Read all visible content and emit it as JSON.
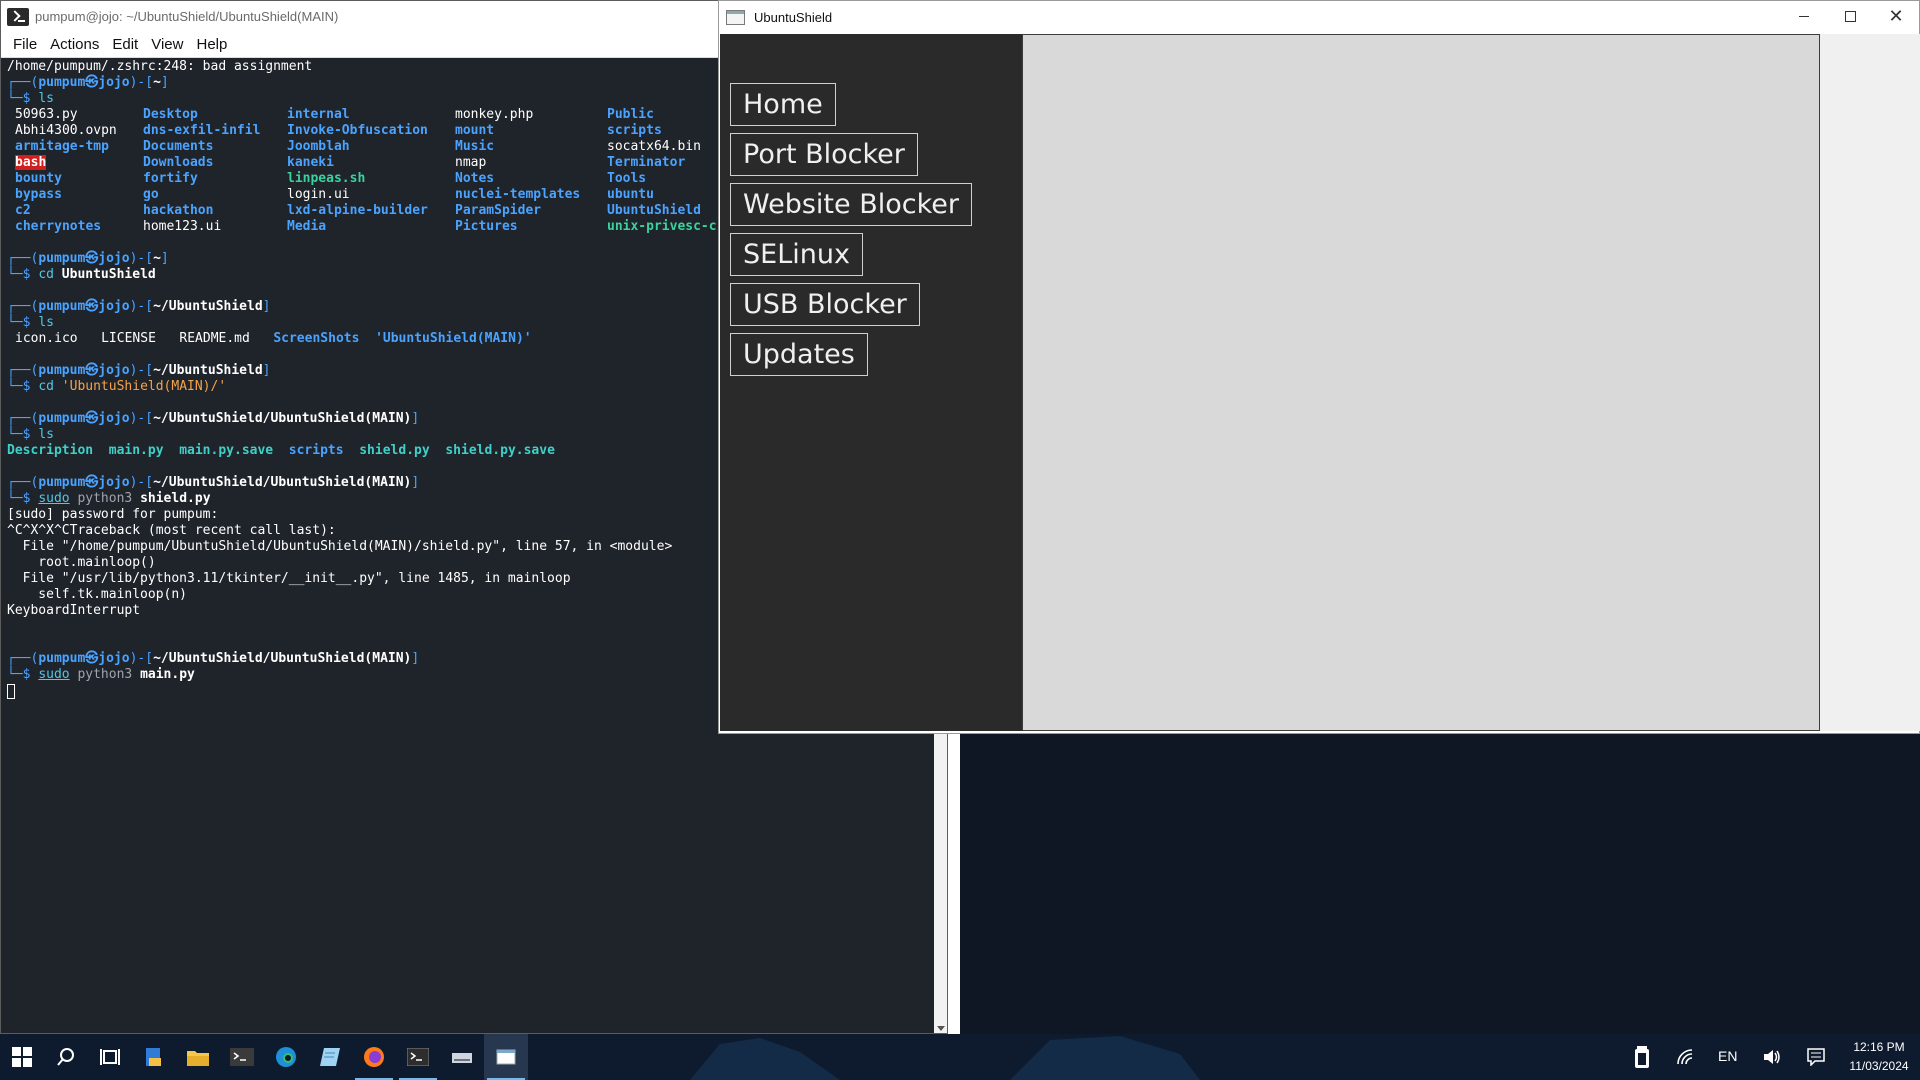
{
  "terminal": {
    "title": "pumpum@jojo: ~/UbuntuShield/UbuntuShield(MAIN)",
    "menu": [
      "File",
      "Actions",
      "Edit",
      "View",
      "Help"
    ],
    "line_zshrc": "/home/pumpum/.zshrc:248: bad assignment",
    "prompt_user": "pumpum",
    "prompt_at": "㉿",
    "prompt_host": "jojo",
    "home": "~",
    "path_us": "~/UbuntuShield",
    "path_main": "~/UbuntuShield/UbuntuShield(MAIN)",
    "cmd_ls": "ls",
    "cmd_cd1": "UbuntuShield",
    "cmd_cd2": "'UbuntuShield(MAIN)/'",
    "cmd_sudo": "sudo",
    "cmd_python": "python3",
    "cmd_shield": "shield.py",
    "cmd_main": "main.py",
    "ls_home": [
      [
        "50963.py",
        "Abhi4300.ovpn",
        "armitage-tmp",
        "bash",
        "bounty",
        "bypass",
        "c2",
        "cherrynotes"
      ],
      [
        "Desktop",
        "dns-exfil-infil",
        "Documents",
        "Downloads",
        "fortify",
        "go",
        "hackathon",
        "home123.ui"
      ],
      [
        "internal",
        "Invoke-Obfuscation",
        "Joomblah",
        "kaneki",
        "linpeas.sh",
        "login.ui",
        "lxd-alpine-builder",
        "Media"
      ],
      [
        "monkey.php",
        "mount",
        "Music",
        "nmap",
        "Notes",
        "nuclei-templates",
        "ParamSpider",
        "Pictures"
      ],
      [
        "Public",
        "scripts",
        "socatx64.bin",
        "Terminator",
        "Tools",
        "ubuntu",
        "UbuntuShield",
        "unix-privesc-c"
      ]
    ],
    "ls_us": [
      "icon.ico",
      "LICENSE",
      "README.md",
      "ScreenShots",
      "'UbuntuShield(MAIN)'"
    ],
    "ls_main": [
      "Description",
      "main.py",
      "main.py.save",
      "scripts",
      "shield.py",
      "shield.py.save"
    ],
    "traceback": [
      "[sudo] password for pumpum:",
      "^C^X^X^CTraceback (most recent call last):",
      "  File \"/home/pumpum/UbuntuShield/UbuntuShield(MAIN)/shield.py\", line 57, in <module>",
      "    root.mainloop()",
      "  File \"/usr/lib/python3.11/tkinter/__init__.py\", line 1485, in mainloop",
      "    self.tk.mainloop(n)",
      "KeyboardInterrupt"
    ]
  },
  "shield": {
    "title": "UbuntuShield",
    "nav": [
      "Home",
      "Port Blocker",
      "Website Blocker",
      "SELinux",
      "USB Blocker",
      "Updates"
    ]
  },
  "taskbar": {
    "icons": [
      "start-icon",
      "search-icon",
      "task-view-icon",
      "file-icon",
      "folder-icon",
      "terminal-icon",
      "edge-icon",
      "notepad-icon",
      "firefox-icon",
      "terminal2-icon",
      "drive-icon",
      "window-icon"
    ],
    "language": "EN",
    "time": "12:16 PM",
    "date": "11/03/2024"
  }
}
